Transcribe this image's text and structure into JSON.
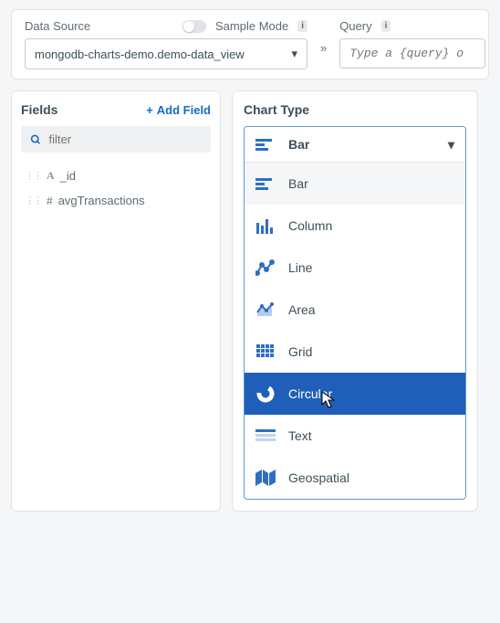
{
  "top": {
    "dataSourceLabel": "Data Source",
    "sampleModeLabel": "Sample Mode",
    "queryLabel": "Query",
    "sourceValue": "mongodb-charts-demo.demo-data_view",
    "queryPlaceholder": "Type a {query} o"
  },
  "fields": {
    "title": "Fields",
    "addLabel": "Add Field",
    "filterPlaceholder": "filter",
    "items": [
      {
        "type": "A",
        "name": "_id"
      },
      {
        "type": "#",
        "name": "avgTransactions"
      }
    ]
  },
  "chartType": {
    "title": "Chart Type",
    "selected": "Bar",
    "options": [
      {
        "label": "Bar",
        "icon": "bar",
        "state": "hover"
      },
      {
        "label": "Column",
        "icon": "column",
        "state": ""
      },
      {
        "label": "Line",
        "icon": "line",
        "state": ""
      },
      {
        "label": "Area",
        "icon": "area",
        "state": ""
      },
      {
        "label": "Grid",
        "icon": "grid",
        "state": ""
      },
      {
        "label": "Circular",
        "icon": "circular",
        "state": "selected"
      },
      {
        "label": "Text",
        "icon": "text",
        "state": ""
      },
      {
        "label": "Geospatial",
        "icon": "geo",
        "state": ""
      }
    ]
  }
}
